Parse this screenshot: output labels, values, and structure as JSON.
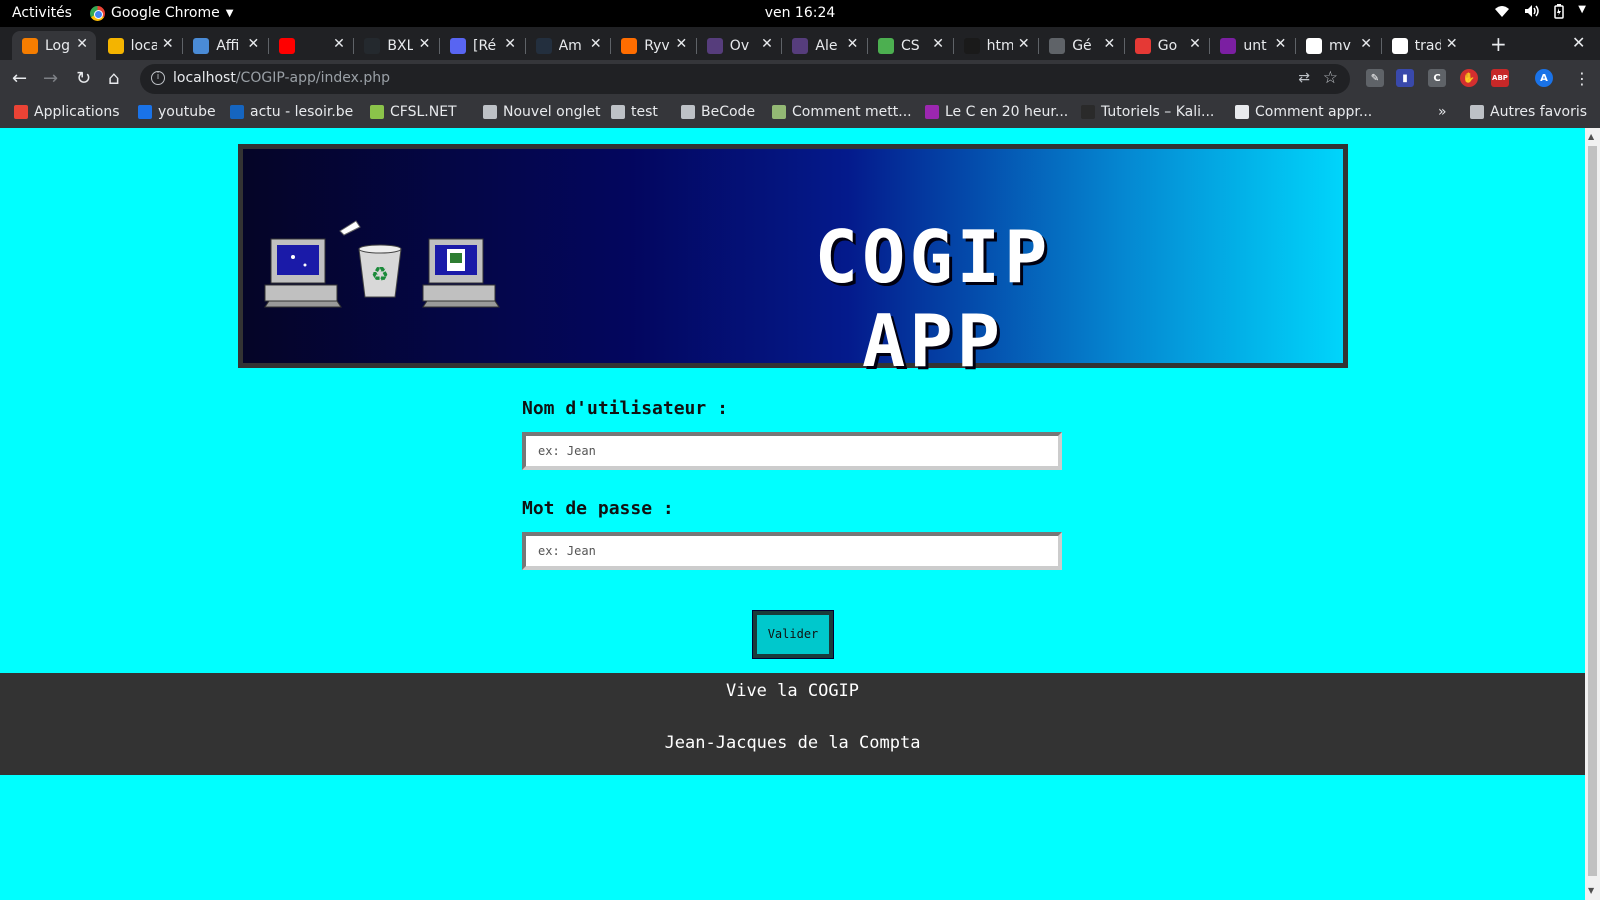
{
  "system": {
    "activities": "Activités",
    "app_name": "Google Chrome",
    "clock": "ven 16:24"
  },
  "tabs": [
    {
      "title": "Log",
      "favicon": "blogger-icon",
      "color": "#f57d00",
      "active": true
    },
    {
      "title": "loca",
      "favicon": "map-icon",
      "color": "#f4b400"
    },
    {
      "title": "Affi",
      "favicon": "image-icon",
      "color": "#4a8bd6"
    },
    {
      "title": "",
      "favicon": "youtube-icon",
      "color": "#ff0000"
    },
    {
      "title": "BXL",
      "favicon": "github-icon",
      "color": "#24292e"
    },
    {
      "title": "[Ré",
      "favicon": "discord-icon",
      "color": "#5865f2"
    },
    {
      "title": "Am",
      "favicon": "amazon-icon",
      "color": "#232f3e"
    },
    {
      "title": "Ryv",
      "favicon": "ryver-icon",
      "color": "#ff6d00"
    },
    {
      "title": "Ov",
      "favicon": "bootstrap-icon",
      "color": "#563d7c"
    },
    {
      "title": "Ale",
      "favicon": "bootstrap-icon",
      "color": "#563d7c"
    },
    {
      "title": "CS",
      "favicon": "css-icon",
      "color": "#4caf50"
    },
    {
      "title": "htm",
      "favicon": "html-icon",
      "color": "#1a1a1a"
    },
    {
      "title": "Gé",
      "favicon": "globe-icon",
      "color": "#5f6368"
    },
    {
      "title": "Go",
      "favicon": "fonts-icon",
      "color": "#e53935"
    },
    {
      "title": "unt",
      "favicon": "diamond-icon",
      "color": "#7b1fa2"
    },
    {
      "title": "mv",
      "favicon": "google-icon",
      "color": "#ffffff"
    },
    {
      "title": "trad",
      "favicon": "google-icon",
      "color": "#ffffff"
    }
  ],
  "toolbar": {
    "url_host": "localhost",
    "url_path": "/COGIP-app/index.php",
    "profile_initial": "A",
    "ext_abp": "ABP",
    "ext_c": "C"
  },
  "bookmarks": [
    {
      "label": "Applications",
      "icon": "apps-grid-icon",
      "color": "#ea4335"
    },
    {
      "label": "youtube",
      "icon": "ip-icon",
      "color": "#1a73e8"
    },
    {
      "label": "actu - lesoir.be",
      "icon": "lesoir-icon",
      "color": "#1565c0"
    },
    {
      "label": "CFSL.NET",
      "icon": "cfsl-icon",
      "color": "#8bc34a"
    },
    {
      "label": "Nouvel onglet",
      "icon": "globe-icon",
      "color": "#bdc1c6"
    },
    {
      "label": "test",
      "icon": "globe-icon",
      "color": "#bdc1c6"
    },
    {
      "label": "BeCode",
      "icon": "folder-icon",
      "color": "#bdc1c6"
    },
    {
      "label": "Comment mett...",
      "icon": "wikihow-icon",
      "color": "#93b874"
    },
    {
      "label": "Le C en 20 heur...",
      "icon": "fun-icon",
      "color": "#9c27b0"
    },
    {
      "label": "Tutoriels – Kali...",
      "icon": "kali-icon",
      "color": "#2a2a2a"
    },
    {
      "label": "Comment appr...",
      "icon": "page-icon",
      "color": "#e8eaed"
    }
  ],
  "bookmarks_other": "Autres favoris",
  "page": {
    "banner_title": "COGIP APP",
    "username_label": "Nom d'utilisateur :",
    "username_placeholder": "ex: Jean",
    "password_label": "Mot de passe :",
    "password_placeholder": "ex: Jean",
    "submit_label": "Valider",
    "footer_line1": "Vive la COGIP",
    "footer_line2": "Jean-Jacques de la Compta"
  }
}
